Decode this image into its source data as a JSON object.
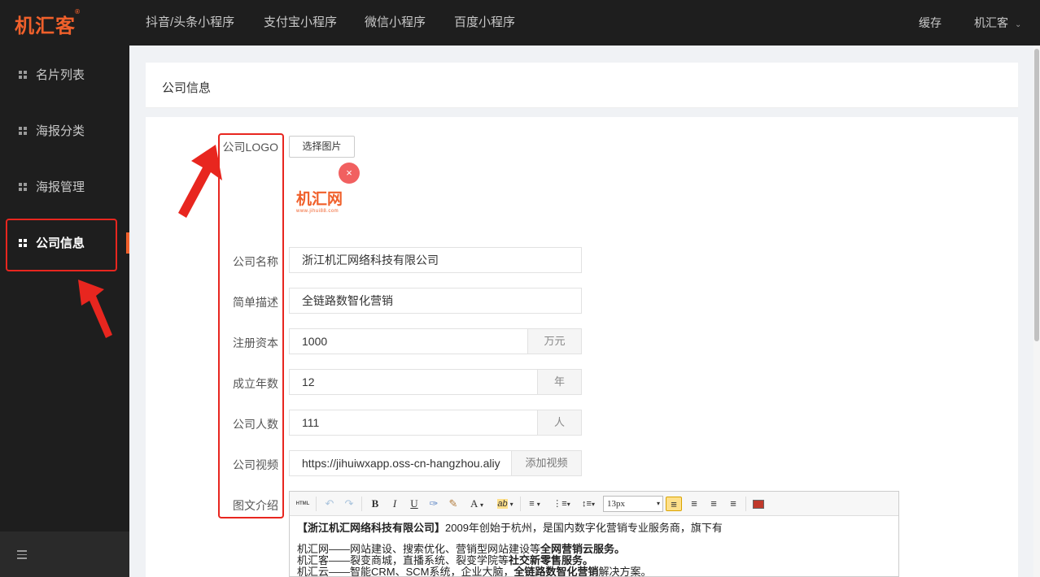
{
  "app": {
    "logo": "机汇客",
    "logo_mark": "®"
  },
  "topnav": {
    "items": [
      "抖音/头条小程序",
      "支付宝小程序",
      "微信小程序",
      "百度小程序"
    ],
    "cache": "缓存",
    "user": "机汇客"
  },
  "sidebar": {
    "items": [
      {
        "label": "名片列表"
      },
      {
        "label": "海报分类"
      },
      {
        "label": "海报管理"
      },
      {
        "label": "公司信息",
        "active": true
      }
    ]
  },
  "page": {
    "title": "公司信息"
  },
  "form": {
    "logo": {
      "label": "公司LOGO",
      "button": "选择图片",
      "preview_text": "机汇网",
      "preview_sub": "www.jihui88.com",
      "remove_icon": "×"
    },
    "name": {
      "label": "公司名称",
      "value": "浙江机汇网络科技有限公司"
    },
    "desc": {
      "label": "简单描述",
      "value": "全链路数智化营销"
    },
    "capital": {
      "label": "注册资本",
      "value": "1000",
      "unit": "万元"
    },
    "years": {
      "label": "成立年数",
      "value": "12",
      "unit": "年"
    },
    "people": {
      "label": "公司人数",
      "value": "111",
      "unit": "人"
    },
    "video": {
      "label": "公司视频",
      "value": "https://jihuiwxapp.oss-cn-hangzhou.aliy",
      "button": "添加视频"
    },
    "intro": {
      "label": "图文介绍"
    }
  },
  "editor": {
    "font_size": "13px",
    "toolbar": {
      "html": "HTML",
      "bold": "B",
      "italic": "I",
      "underline": "U",
      "font_color": "A"
    },
    "lines": {
      "l1_bold": "【浙江机汇网络科技有限公司】",
      "l1_rest": "2009年创始于杭州，是国内数字化营销专业服务商，旗下有",
      "l2_a": "机汇网——网站建设、搜索优化、营销型网站建设等",
      "l2_b": "全网营销云服务。",
      "l3_a": "机汇客——裂变商城，直播系统、裂变学院等",
      "l3_b": "社交新零售服务。",
      "l4_a": "机汇云——智能CRM、SCM系统，企业大脑，",
      "l4_b": "全链路数智化营销",
      "l4_c": "解决方案。"
    }
  },
  "colors": {
    "brand": "#f0602b",
    "annotation": "#e8261f",
    "sidebar_bg": "#1e1e1e"
  }
}
